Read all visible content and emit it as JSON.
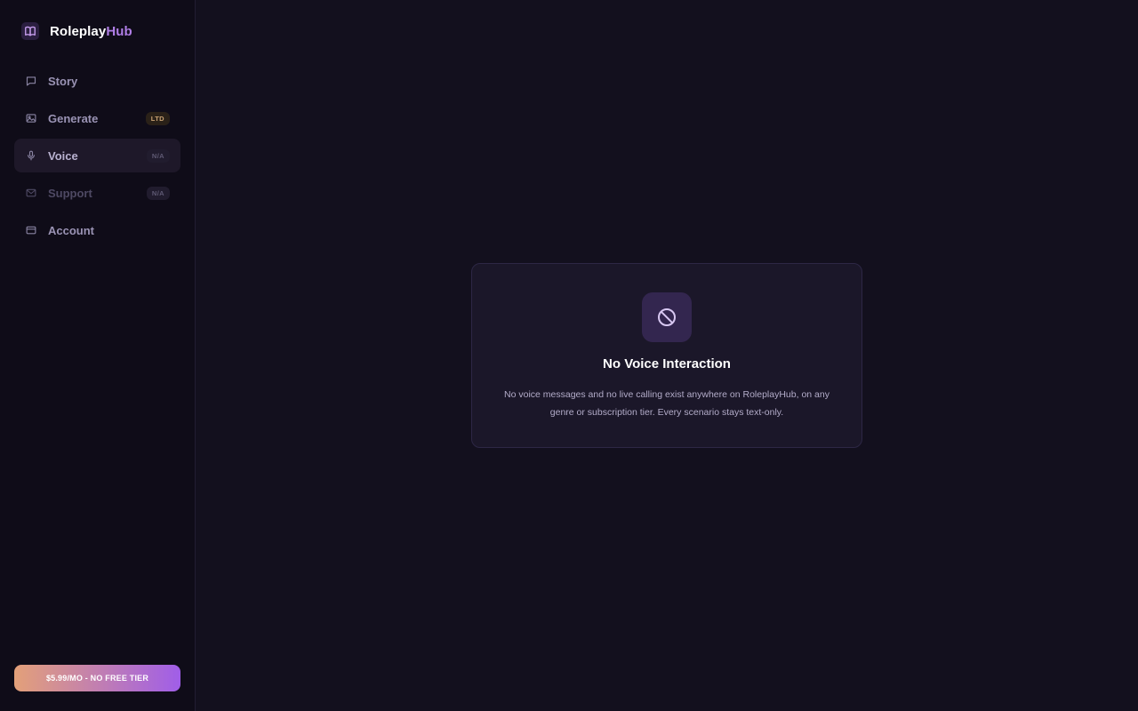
{
  "brand": {
    "name_part1": "Roleplay",
    "name_part2": "Hub",
    "icon": "book-icon"
  },
  "sidebar": {
    "items": [
      {
        "label": "Story",
        "icon": "chat-bubble-icon",
        "badge": ""
      },
      {
        "label": "Generate",
        "icon": "image-icon",
        "badge": "LTD"
      },
      {
        "label": "Voice",
        "icon": "microphone-icon",
        "badge": "N/A",
        "active": true
      },
      {
        "label": "Support",
        "icon": "mail-icon",
        "badge": "N/A"
      },
      {
        "label": "Account",
        "icon": "credit-card-icon",
        "badge": ""
      }
    ],
    "cta_label": "$5.99/MO - NO FREE TIER"
  },
  "main": {
    "card": {
      "icon": "prohibited-icon",
      "title": "No Voice Interaction",
      "text": "No voice messages and no live calling exist anywhere on RoleplayHub, on any genre or subscription tier. Every scenario stays text-only."
    }
  },
  "colors": {
    "background": "#13101e",
    "sidebar": "#0f0c18",
    "accent": "#b07ee6",
    "cta_gradient_start": "#e3a079",
    "cta_gradient_end": "#a05ee8"
  }
}
